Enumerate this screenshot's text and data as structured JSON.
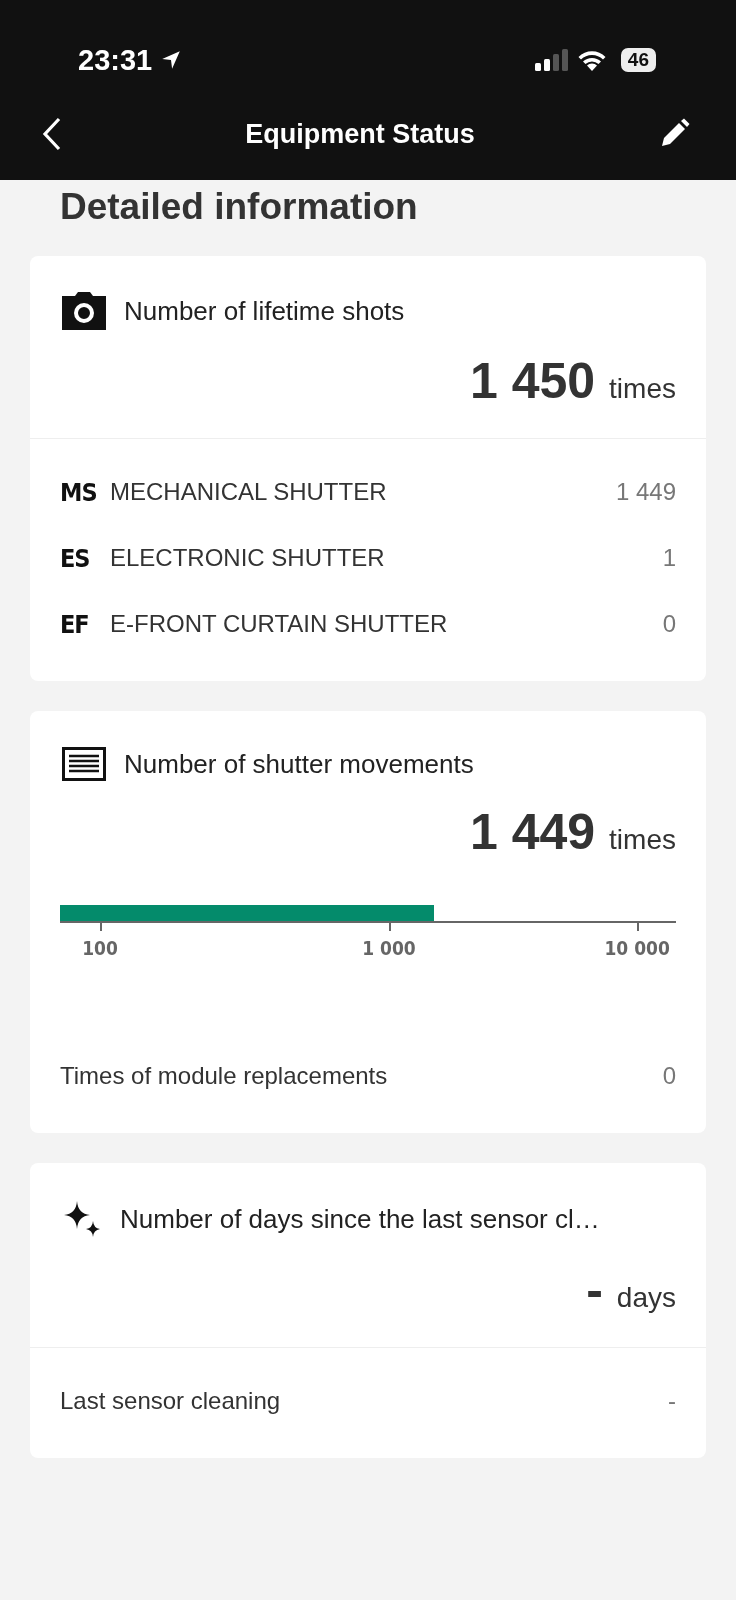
{
  "status_bar": {
    "time": "23:31",
    "battery": "46"
  },
  "nav": {
    "title": "Equipment Status"
  },
  "heading": "Detailed information",
  "cards": [
    {
      "kind": "shots",
      "title": "Number of lifetime shots",
      "value": "1 450",
      "unit": "times",
      "rows": [
        {
          "badge": "MS",
          "label": "MECHANICAL SHUTTER",
          "value": "1 449"
        },
        {
          "badge": "ES",
          "label": "ELECTRONIC SHUTTER",
          "value": "1"
        },
        {
          "badge": "EF",
          "label": "E-FRONT CURTAIN SHUTTER",
          "value": "0"
        }
      ]
    },
    {
      "kind": "shutter",
      "title": "Number of shutter movements",
      "value": "1 449",
      "unit": "times",
      "meter": {
        "level": 0.607,
        "ticks": [
          "100",
          "1 000",
          "10 000"
        ]
      },
      "rows": [
        {
          "label": "Times of module replacements",
          "value": "0"
        }
      ]
    },
    {
      "kind": "sensor",
      "title": "Number of days since the last sensor cl…",
      "value": "-",
      "unit": "days",
      "rows": [
        {
          "label": "Last sensor cleaning",
          "value": "-"
        }
      ]
    }
  ]
}
